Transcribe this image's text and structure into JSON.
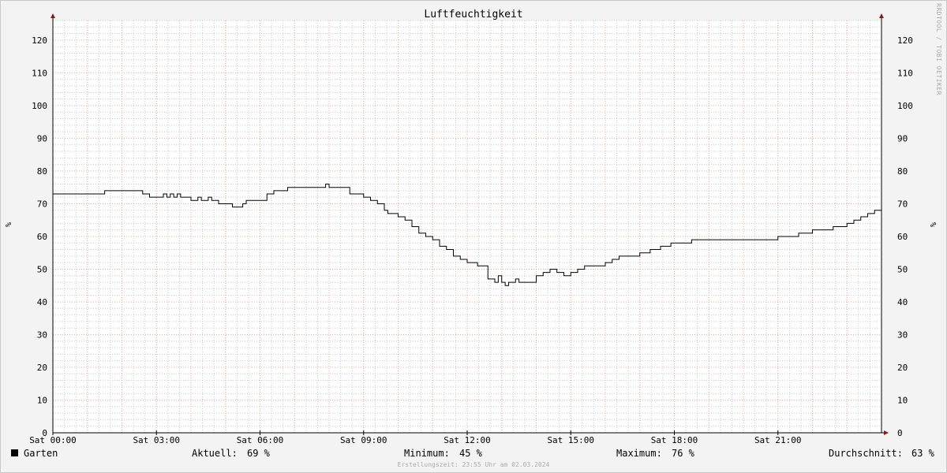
{
  "chart_data": {
    "type": "line",
    "title": "Luftfeuchtigkeit",
    "ylabel": "%",
    "watermark": "RRDTOOL / TOBI OETIKER",
    "ylim": [
      0,
      126
    ],
    "y_ticks": [
      0,
      10,
      20,
      30,
      40,
      50,
      60,
      70,
      80,
      90,
      100,
      110,
      120
    ],
    "x_range_hours": [
      0,
      24
    ],
    "x_ticks": [
      {
        "hour": 0,
        "label": "Sat 00:00"
      },
      {
        "hour": 3,
        "label": "Sat 03:00"
      },
      {
        "hour": 6,
        "label": "Sat 06:00"
      },
      {
        "hour": 9,
        "label": "Sat 09:00"
      },
      {
        "hour": 12,
        "label": "Sat 12:00"
      },
      {
        "hour": 15,
        "label": "Sat 15:00"
      },
      {
        "hour": 18,
        "label": "Sat 18:00"
      },
      {
        "hour": 21,
        "label": "Sat 21:00"
      }
    ],
    "grid": true,
    "colors": {
      "line": "#000000",
      "major_grid": "#f4a3a3",
      "minor_grid": "#c9c9c9",
      "axis": "#000000",
      "arrow": "#8b1a1a",
      "background": "#ffffff"
    },
    "series": [
      {
        "name": "Garten",
        "x": [
          0,
          0.9,
          1.5,
          2.5,
          2.6,
          2.8,
          3.0,
          3.2,
          3.3,
          3.4,
          3.5,
          3.6,
          3.7,
          3.8,
          4.0,
          4.2,
          4.3,
          4.5,
          4.6,
          4.8,
          5.0,
          5.2,
          5.4,
          5.5,
          5.6,
          6.0,
          6.2,
          6.4,
          6.6,
          6.8,
          7.0,
          7.5,
          7.9,
          8.0,
          8.3,
          8.6,
          8.8,
          9.0,
          9.2,
          9.4,
          9.6,
          9.7,
          9.8,
          10.0,
          10.2,
          10.4,
          10.6,
          10.8,
          11.0,
          11.2,
          11.4,
          11.6,
          11.8,
          12.0,
          12.3,
          12.6,
          12.8,
          12.9,
          13.0,
          13.1,
          13.2,
          13.4,
          13.5,
          13.6,
          13.8,
          14.0,
          14.2,
          14.4,
          14.6,
          14.8,
          15.0,
          15.2,
          15.4,
          15.6,
          16.0,
          16.2,
          16.4,
          16.6,
          17.0,
          17.3,
          17.6,
          17.9,
          18.2,
          18.5,
          19.0,
          20.0,
          21.0,
          21.6,
          22.0,
          22.6,
          22.8,
          23.0,
          23.2,
          23.4,
          23.6,
          23.8,
          24.0
        ],
        "values": [
          73,
          73,
          74,
          74,
          73,
          72,
          72,
          73,
          72,
          73,
          72,
          73,
          72,
          72,
          71,
          72,
          71,
          72,
          71,
          70,
          70,
          69,
          69,
          70,
          71,
          71,
          73,
          74,
          74,
          75,
          75,
          75,
          76,
          75,
          75,
          73,
          73,
          72,
          71,
          70,
          68,
          67,
          67,
          66,
          65,
          63,
          61,
          60,
          59,
          57,
          56,
          54,
          53,
          52,
          51,
          47,
          46,
          48,
          46,
          45,
          46,
          47,
          46,
          46,
          46,
          48,
          49,
          50,
          49,
          48,
          49,
          50,
          51,
          51,
          52,
          53,
          54,
          54,
          55,
          56,
          57,
          58,
          58,
          59,
          59,
          59,
          60,
          61,
          62,
          63,
          63,
          64,
          65,
          66,
          67,
          68,
          69
        ]
      }
    ]
  },
  "legend": {
    "series_name": "Garten",
    "current_label": "Aktuell:",
    "current_value": "69 %",
    "min_label": "Minimum:",
    "min_value": "45 %",
    "max_label": "Maximum:",
    "max_value": "76 %",
    "avg_label": "Durchschnitt:",
    "avg_value": "63 %"
  },
  "footer_text": "Erstellungszeit: 23:55 Uhr am 02.03.2024"
}
